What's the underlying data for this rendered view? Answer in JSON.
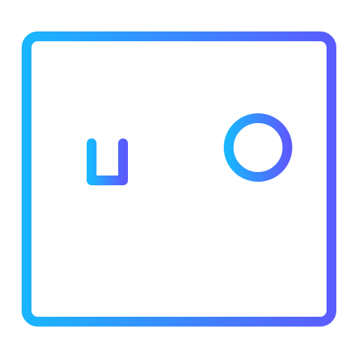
{
  "icon": {
    "name": "browser-window-key-icon",
    "description_text": "",
    "colors": {
      "gradient_start": "#19B5FE",
      "gradient_end": "#5B5CFF",
      "background": "#FFFFFF"
    }
  }
}
